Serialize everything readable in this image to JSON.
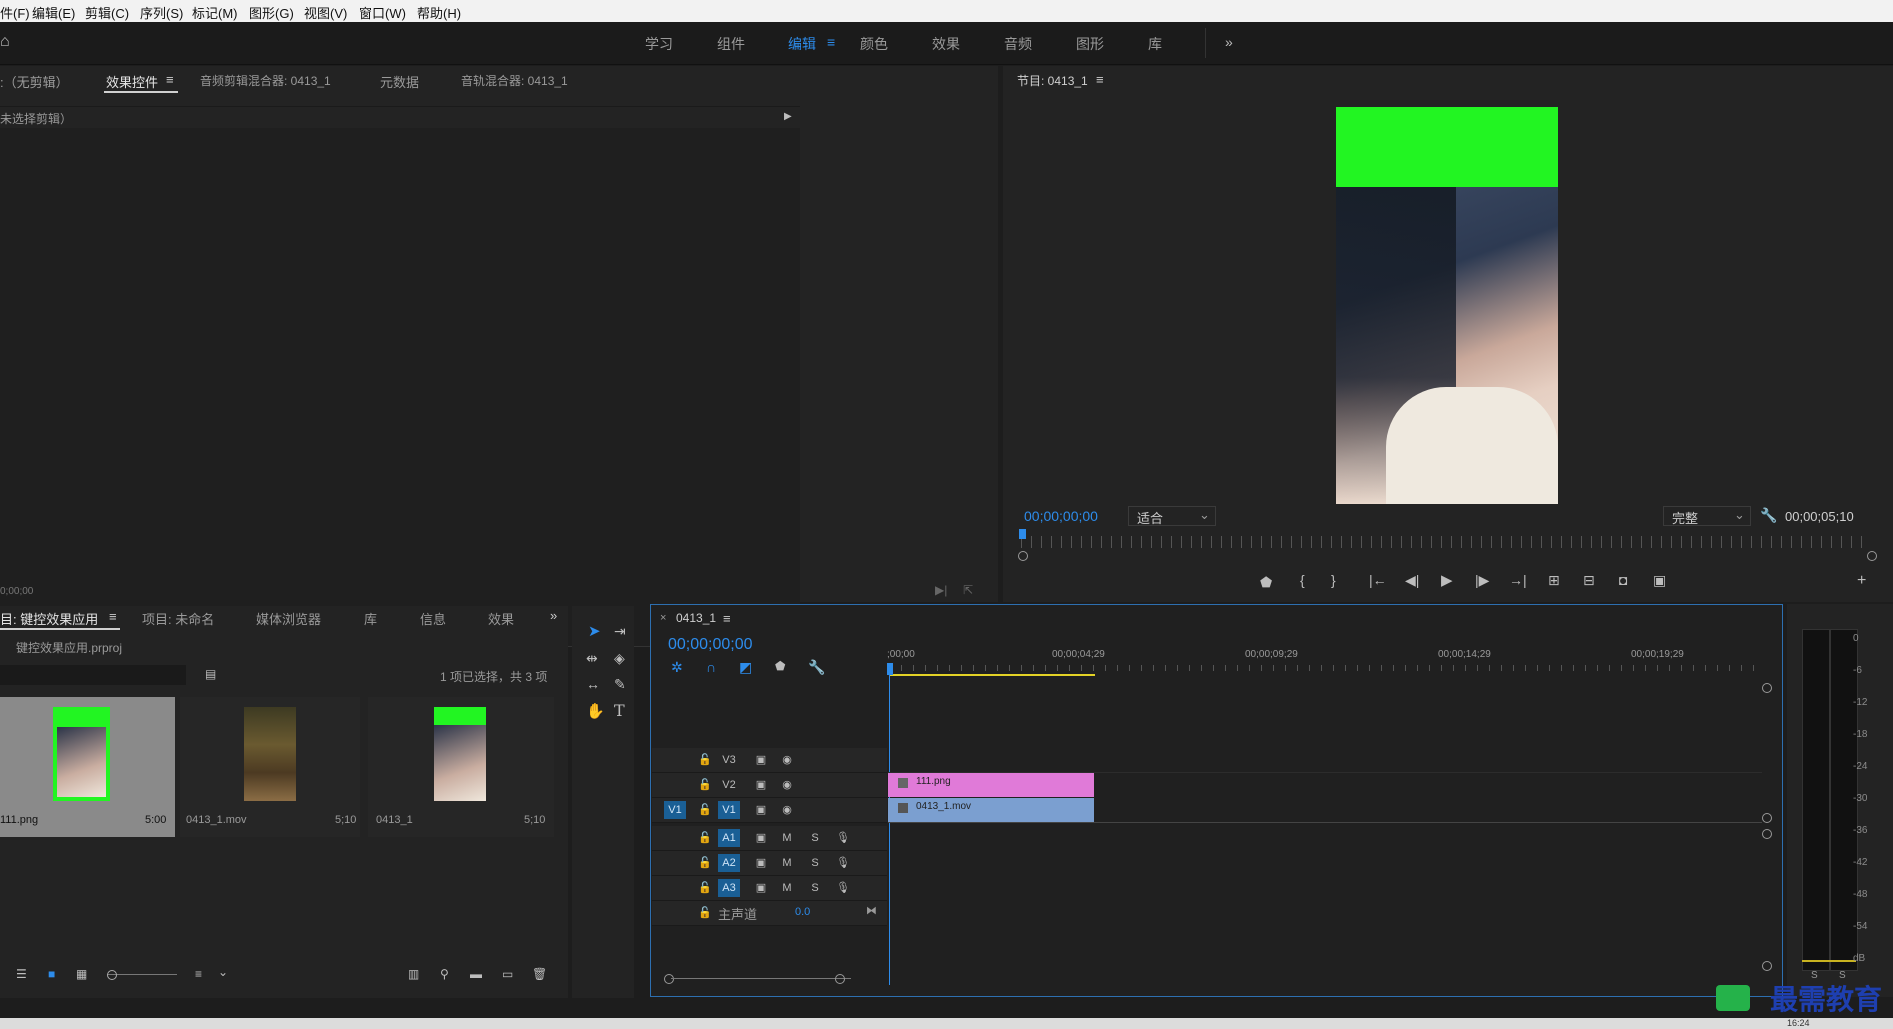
{
  "menu": [
    "件(F)",
    "编辑(E)",
    "剪辑(C)",
    "序列(S)",
    "标记(M)",
    "图形(G)",
    "视图(V)",
    "窗口(W)",
    "帮助(H)"
  ],
  "workspaces": [
    "学习",
    "组件",
    "编辑",
    "颜色",
    "效果",
    "音频",
    "图形",
    "库"
  ],
  "source_panel": {
    "tabs": [
      ":（无剪辑）",
      "效果控件",
      "音频剪辑混合器: 0413_1",
      "元数据",
      "音轨混合器: 0413_1"
    ],
    "no_clip_text": "未选择剪辑）",
    "timecode": "0;00;00"
  },
  "program_monitor": {
    "title": "节目: 0413_1",
    "timecode": "00;00;00;00",
    "fit": "适合",
    "quality": "完整",
    "duration": "00;00;05;10"
  },
  "project_panel": {
    "tabs": [
      "目: 键控效果应用",
      "项目: 未命名",
      "媒体浏览器",
      "库",
      "信息",
      "效果"
    ],
    "project_file": "键控效果应用.prproj",
    "selection_info": "1 项已选择，共 3 项",
    "items": [
      {
        "name": "111.png",
        "duration": "5:00"
      },
      {
        "name": "0413_1.mov",
        "duration": "5;10"
      },
      {
        "name": "0413_1",
        "duration": "5;10"
      }
    ]
  },
  "timeline": {
    "sequence": "0413_1",
    "timecode": "00;00;00;00",
    "ruler": [
      ";00;00",
      "00;00;04;29",
      "00;00;09;29",
      "00;00;14;29",
      "00;00;19;29"
    ],
    "video_tracks": [
      "V3",
      "V2",
      "V1"
    ],
    "audio_tracks": [
      "A1",
      "A2",
      "A3"
    ],
    "source_patch": "V1",
    "master_label": "主声道",
    "master_value": "0.0",
    "clips": [
      {
        "name": "111.png",
        "track": "V2",
        "color": "#e07ad8"
      },
      {
        "name": "0413_1.mov",
        "track": "V1",
        "color": "#7b9fd0"
      }
    ]
  },
  "meter": {
    "scale": [
      "0",
      "-6",
      "-12",
      "-18",
      "-24",
      "-30",
      "-36",
      "-42",
      "-48",
      "-54",
      "dB"
    ],
    "solo_labels": [
      "S",
      "S"
    ]
  },
  "watermark": "最需教育",
  "clock": "16:24"
}
